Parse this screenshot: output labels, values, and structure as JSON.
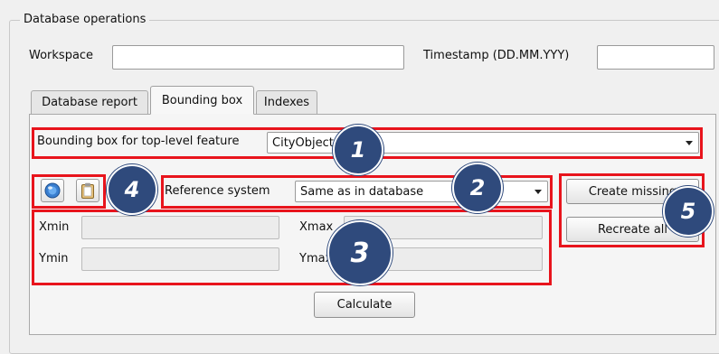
{
  "group_title": "Database operations",
  "workspace": {
    "label": "Workspace",
    "value": ""
  },
  "timestamp": {
    "label": "Timestamp (DD.MM.YYY)",
    "value": ""
  },
  "tabs": [
    {
      "label": "Database report",
      "active": false
    },
    {
      "label": "Bounding box",
      "active": true
    },
    {
      "label": "Indexes",
      "active": false
    }
  ],
  "feature": {
    "label": "Bounding box for top-level feature",
    "selected": "CityObject"
  },
  "reference_system": {
    "label": "Reference system",
    "selected": "Same as in database"
  },
  "coords": {
    "xmin": {
      "label": "Xmin",
      "value": ""
    },
    "xmax": {
      "label": "Xmax",
      "value": ""
    },
    "ymin": {
      "label": "Ymin",
      "value": ""
    },
    "ymax": {
      "label": "Ymax",
      "value": ""
    }
  },
  "buttons": {
    "calculate": "Calculate",
    "create_missing": "Create missing",
    "recreate_all": "Recreate all"
  },
  "icons": {
    "map": "globe-icon",
    "clipboard": "clipboard-icon"
  },
  "annotations": [
    "1",
    "2",
    "3",
    "4",
    "5"
  ],
  "colors": {
    "highlight": "#e8141c",
    "badge": "#2f4a7c"
  }
}
